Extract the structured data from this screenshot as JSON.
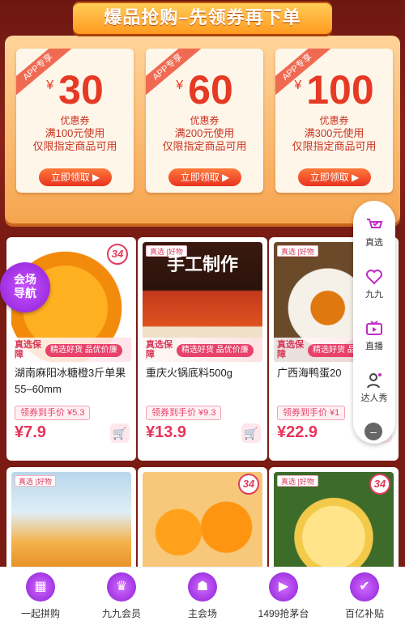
{
  "banner": {
    "title": "爆品抢购–先领券再下单"
  },
  "coupons": [
    {
      "ribbon": "APP专享",
      "yen": "¥",
      "amount": "30",
      "label": "优惠券",
      "condition": "满100元使用",
      "scope": "仅限指定商品可用",
      "button": "立即领取 ▶"
    },
    {
      "ribbon": "APP专享",
      "yen": "¥",
      "amount": "60",
      "label": "优惠券",
      "condition": "满200元使用",
      "scope": "仅限指定商品可用",
      "button": "立即领取 ▶"
    },
    {
      "ribbon": "APP专享",
      "yen": "¥",
      "amount": "100",
      "label": "优惠券",
      "condition": "满300元使用",
      "scope": "仅限指定商品可用",
      "button": "立即领取 ▶"
    }
  ],
  "venue_nav": {
    "line1": "会场",
    "line2": "导航"
  },
  "products": [
    {
      "brand": "真选 |好物",
      "badge": "34",
      "guarantee": "真选保障",
      "slogan": "精选好货 品优价廉",
      "name": "湖南麻阳冰糖橙3斤单果55–60mm",
      "coupon_price": "领券到手价 ¥5.3",
      "price": "¥7.9",
      "img": "orange"
    },
    {
      "brand": "真选 |好物",
      "badge": "",
      "guarantee": "真选保障",
      "slogan": "精选好货 品优价廉",
      "name": "重庆火锅底料500g",
      "coupon_price": "领券到手价 ¥9.3",
      "price": "¥13.9",
      "img": "hotpot",
      "img_text": "手工制作"
    },
    {
      "brand": "真选 |好物",
      "badge": "",
      "guarantee": "真选保障",
      "slogan": "精选好货 品优价廉",
      "name": "广西海鸭蛋20",
      "coupon_price": "领券到手价 ¥1",
      "price": "¥22.9",
      "img": "egg"
    },
    {
      "brand": "真选 |好物",
      "badge": "",
      "img": "pickle"
    },
    {
      "brand": "",
      "badge": "34",
      "img": "mandarin"
    },
    {
      "brand": "真选 |好物",
      "badge": "34",
      "img": "pomelo"
    }
  ],
  "sidebar": [
    {
      "label": "真选",
      "icon": "cart-check-icon"
    },
    {
      "label": "九九",
      "icon": "heart-icon"
    },
    {
      "label": "直播",
      "icon": "tv-icon"
    },
    {
      "label": "达人秀",
      "icon": "user-star-icon"
    }
  ],
  "bottom_nav": [
    {
      "label": "一起拼购",
      "icon": "grid-icon"
    },
    {
      "label": "九九会员",
      "icon": "crown-icon"
    },
    {
      "label": "主会场",
      "icon": "venue-icon"
    },
    {
      "label": "1499抢茅台",
      "icon": "bottle-icon"
    },
    {
      "label": "百亿补贴",
      "icon": "subsidy-icon"
    }
  ],
  "colors": {
    "bg": "#7a1c14",
    "accent": "#e8335a",
    "coupon_red": "#e63a24",
    "tray": "#f6a54e"
  }
}
